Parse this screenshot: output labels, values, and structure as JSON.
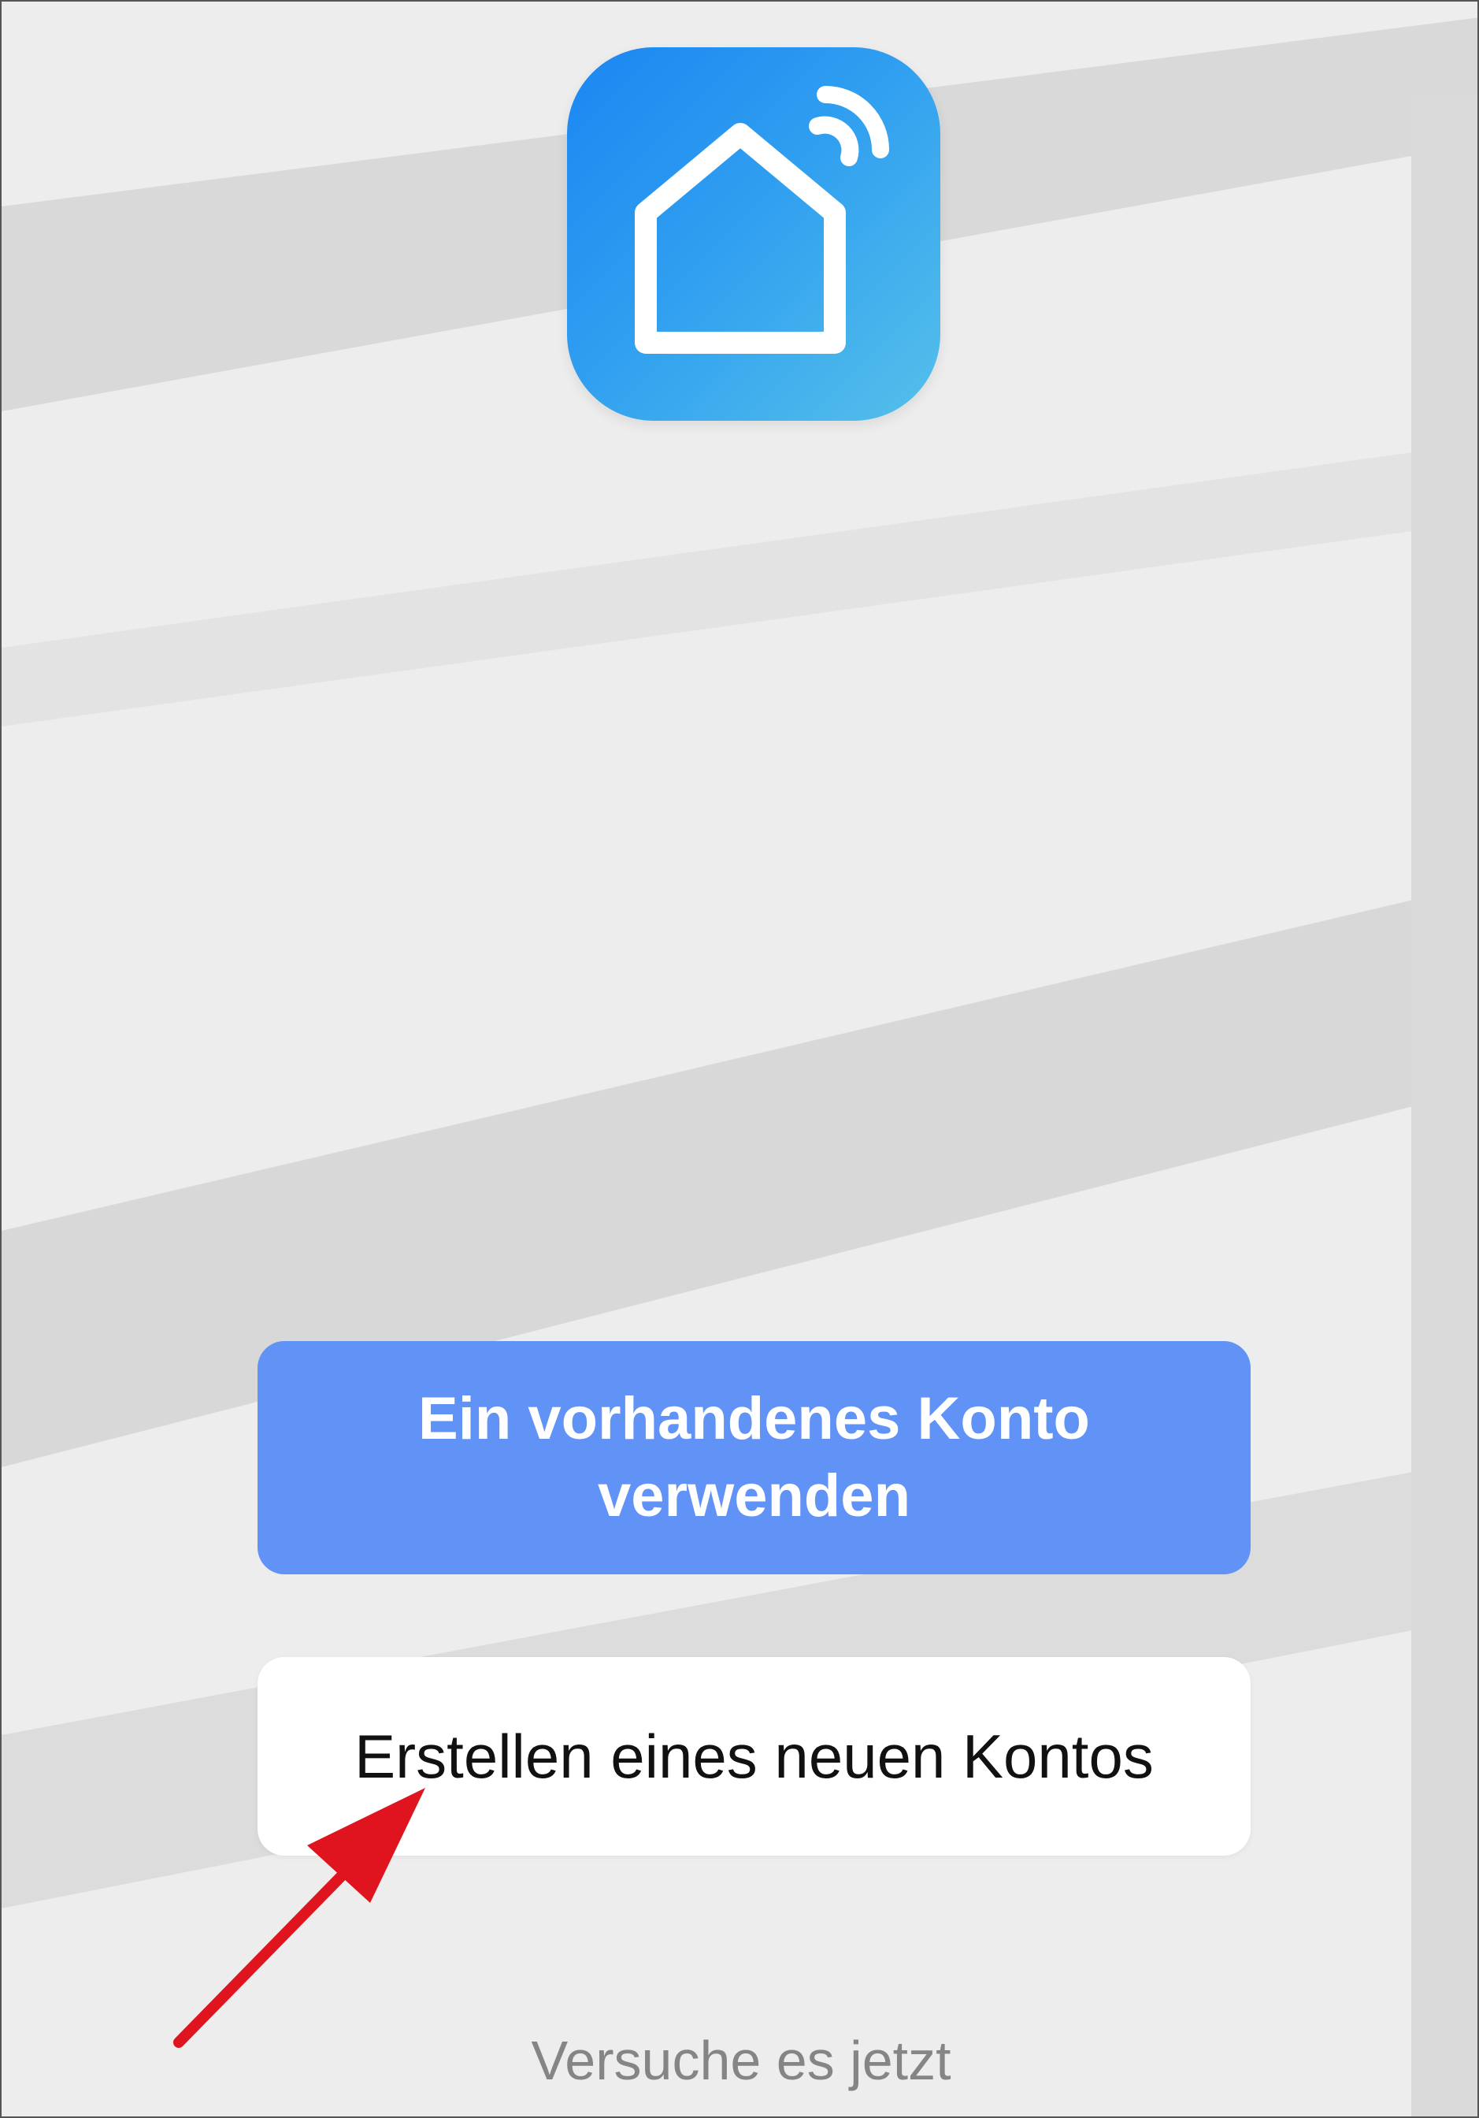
{
  "app": {
    "icon": "smart-home-wifi-icon",
    "icon_colors": {
      "top_left": "#1a86f2",
      "bottom_right": "#55c0ea"
    }
  },
  "actions": {
    "login_label": "Ein vorhandenes Konto verwenden",
    "register_label": "Erstellen eines neuen Kontos",
    "try_label": "Versuche es jetzt"
  },
  "colors": {
    "primary_button": "#6192f6",
    "secondary_button": "#ffffff",
    "annotation_arrow": "#e0141e",
    "background": "#ededed"
  }
}
